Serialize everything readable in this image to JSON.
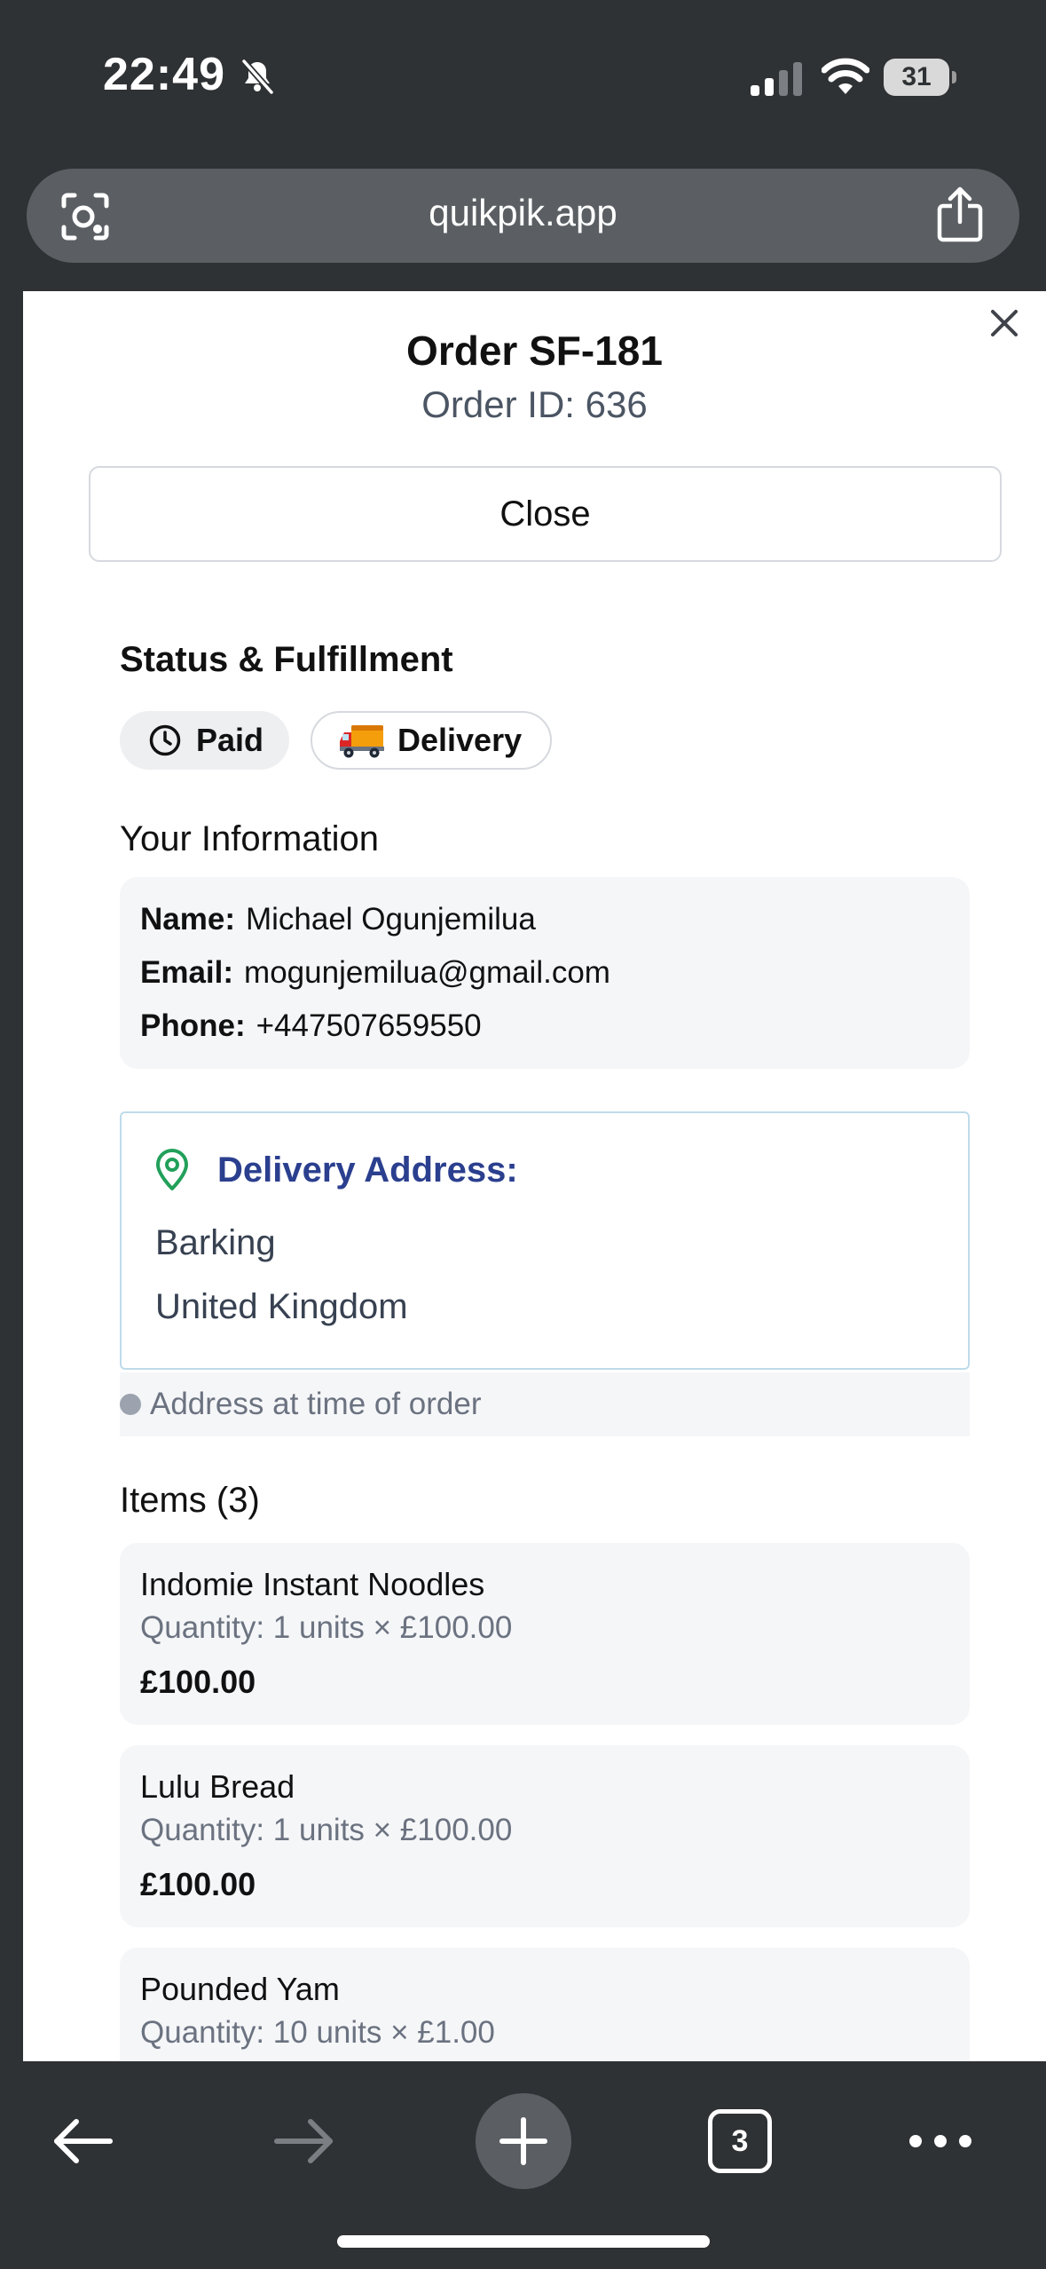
{
  "status_bar": {
    "time": "22:49",
    "battery": "31",
    "icons": [
      "bell-off-icon",
      "signal-icon",
      "wifi-icon",
      "battery-icon"
    ]
  },
  "browser": {
    "url": "quikpik.app",
    "icons": [
      "lens-icon",
      "share-icon"
    ],
    "toolbar": {
      "tab_count": "3",
      "icons": [
        "back-icon",
        "forward-icon",
        "plus-icon",
        "more-icon"
      ]
    }
  },
  "modal": {
    "title": "Order SF-181",
    "subtitle": "Order ID: 636",
    "close_label": "Close"
  },
  "status_section": {
    "title": "Status & Fulfillment",
    "payment_status": "Paid",
    "fulfillment": "Delivery"
  },
  "customer": {
    "title": "Your Information",
    "name_label": "Name:",
    "name": "Michael Ogunjemilua",
    "email_label": "Email:",
    "email": "mogunjemilua@gmail.com",
    "phone_label": "Phone:",
    "phone": "+447507659550"
  },
  "address": {
    "label": "Delivery Address:",
    "lines": [
      "Barking",
      "United Kingdom"
    ],
    "note": "Address at time of order"
  },
  "items": {
    "title": "Items (3)",
    "list": [
      {
        "name": "Indomie Instant Noodles",
        "quantity": "Quantity: 1 units × £100.00",
        "total": "£100.00"
      },
      {
        "name": "Lulu Bread",
        "quantity": "Quantity: 1 units × £100.00",
        "total": "£100.00"
      },
      {
        "name": "Pounded Yam",
        "quantity": "Quantity: 10 units × £1.00",
        "total": ""
      }
    ]
  },
  "colors": {
    "chrome": "#2f3234",
    "address_label": "#2b3f8f",
    "pin": "#22a05a",
    "address_border": "#bfdbea"
  }
}
